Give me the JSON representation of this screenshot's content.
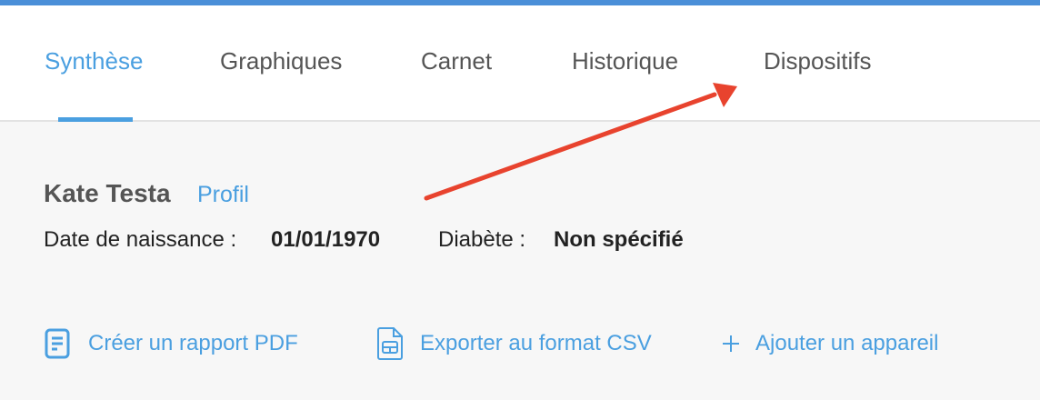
{
  "tabs": [
    {
      "label": "Synthèse",
      "active": true
    },
    {
      "label": "Graphiques",
      "active": false
    },
    {
      "label": "Carnet",
      "active": false
    },
    {
      "label": "Historique",
      "active": false
    },
    {
      "label": "Dispositifs",
      "active": false
    }
  ],
  "patient": {
    "name": "Kate Testa",
    "profile_link": "Profil",
    "birth_label": "Date de naissance :",
    "birth_value": "01/01/1970",
    "diabetes_label": "Diabète :",
    "diabetes_value": "Non spécifié"
  },
  "actions": {
    "pdf": {
      "label": "Créer un rapport PDF",
      "icon": "document-icon"
    },
    "csv": {
      "label": "Exporter au format CSV",
      "icon": "spreadsheet-file-icon"
    },
    "device": {
      "label": "Ajouter un appareil",
      "icon": "plus-icon"
    }
  },
  "colors": {
    "accent": "#4a9fe0",
    "top_bar": "#4a8fd8",
    "annotation_arrow": "#e8432e"
  }
}
